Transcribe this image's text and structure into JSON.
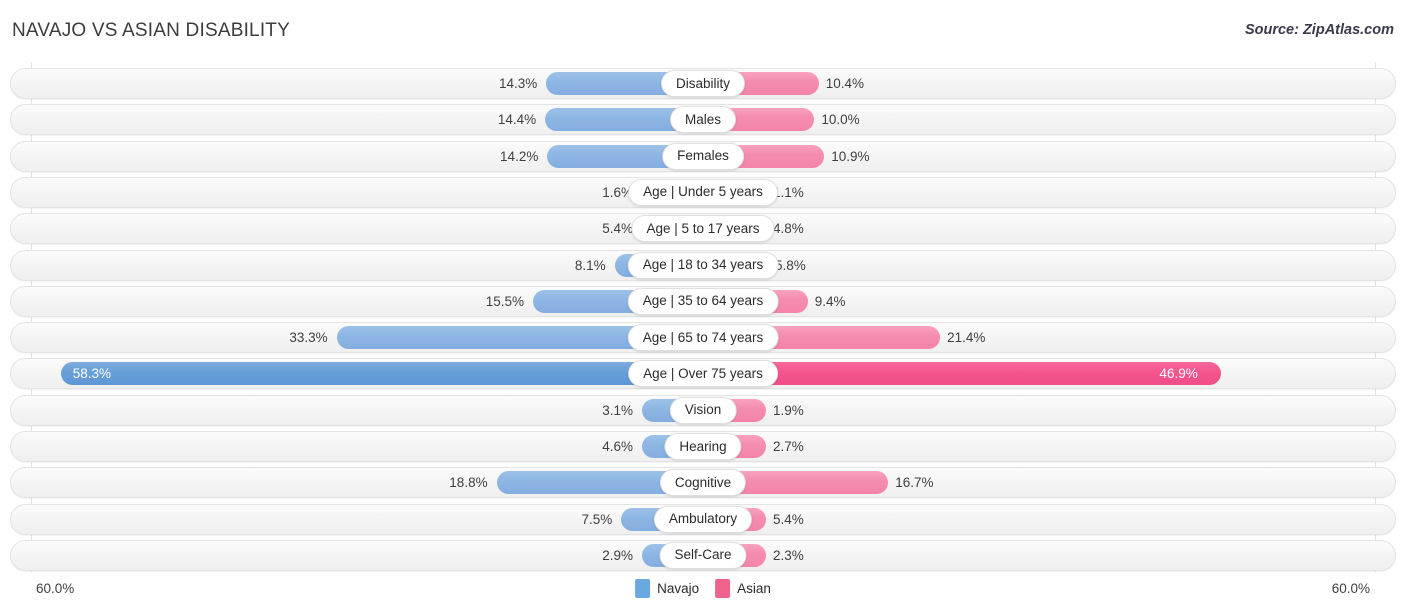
{
  "header": {
    "title": "NAVAJO VS ASIAN DISABILITY",
    "source": "Source: ZipAtlas.com"
  },
  "axis": {
    "left_max_label": "60.0%",
    "right_max_label": "60.0%"
  },
  "legend": {
    "items": [
      {
        "label": "Navajo",
        "color": "#6aa8e0"
      },
      {
        "label": "Asian",
        "color": "#f0648c"
      }
    ]
  },
  "colors": {
    "navajo_normal": "#8fb7e4",
    "asian_normal": "#f58db1",
    "navajo_highlight": "#5d97d5",
    "asian_highlight": "#f14c87",
    "row_track": "#f4f4f4",
    "gridline": "#e2e2e2",
    "text": "#3f3f3f"
  },
  "chart_data": {
    "type": "bar",
    "orientation": "horizontal-diverging",
    "title": "NAVAJO VS ASIAN DISABILITY",
    "xlabel": "",
    "ylabel": "",
    "xlim": [
      60.0,
      60.0
    ],
    "grid": true,
    "legend_position": "bottom-center",
    "categories": [
      "Disability",
      "Males",
      "Females",
      "Age | Under 5 years",
      "Age | 5 to 17 years",
      "Age | 18 to 34 years",
      "Age | 35 to 64 years",
      "Age | 65 to 74 years",
      "Age | Over 75 years",
      "Vision",
      "Hearing",
      "Cognitive",
      "Ambulatory",
      "Self-Care"
    ],
    "series": [
      {
        "name": "Navajo",
        "side": "left",
        "values": [
          14.3,
          14.4,
          14.2,
          1.6,
          5.4,
          8.1,
          15.5,
          33.3,
          58.3,
          3.1,
          4.6,
          18.8,
          7.5,
          2.9
        ],
        "value_labels": [
          "14.3%",
          "14.4%",
          "14.2%",
          "1.6%",
          "5.4%",
          "8.1%",
          "15.5%",
          "33.3%",
          "58.3%",
          "3.1%",
          "4.6%",
          "18.8%",
          "7.5%",
          "2.9%"
        ]
      },
      {
        "name": "Asian",
        "side": "right",
        "values": [
          10.4,
          10.0,
          10.9,
          1.1,
          4.8,
          5.8,
          9.4,
          21.4,
          46.9,
          1.9,
          2.7,
          16.7,
          5.4,
          2.3
        ],
        "value_labels": [
          "10.4%",
          "10.0%",
          "10.9%",
          "1.1%",
          "4.8%",
          "5.8%",
          "9.4%",
          "21.4%",
          "46.9%",
          "1.9%",
          "2.7%",
          "16.7%",
          "5.4%",
          "2.3%"
        ]
      }
    ],
    "highlighted_category": "Age | Over 75 years"
  }
}
